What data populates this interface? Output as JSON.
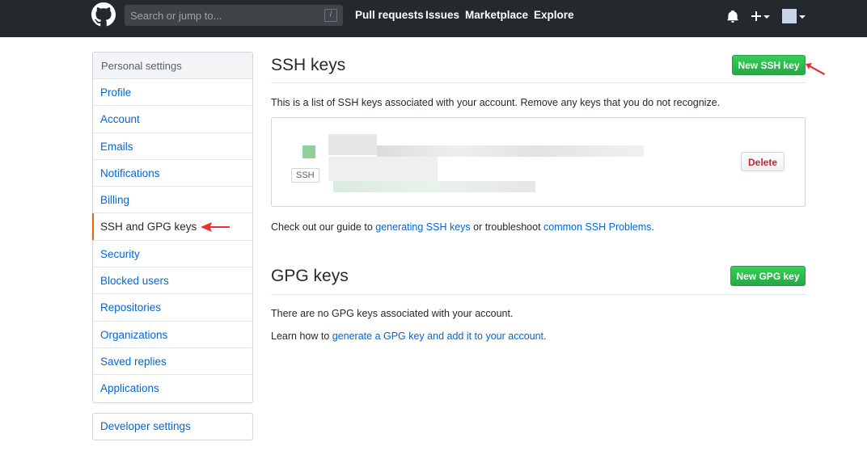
{
  "header": {
    "search_placeholder": "Search or jump to...",
    "slash_key": "/",
    "nav": [
      "Pull requests",
      "Issues",
      "Marketplace",
      "Explore"
    ]
  },
  "sidebar": {
    "heading": "Personal settings",
    "items": [
      "Profile",
      "Account",
      "Emails",
      "Notifications",
      "Billing",
      "SSH and GPG keys",
      "Security",
      "Blocked users",
      "Repositories",
      "Organizations",
      "Saved replies",
      "Applications"
    ],
    "selected_index": 5,
    "developer_settings": "Developer settings"
  },
  "ssh": {
    "title": "SSH keys",
    "new_button": "New SSH key",
    "description": "This is a list of SSH keys associated with your account. Remove any keys that you do not recognize.",
    "key_label": "SSH",
    "delete_button": "Delete",
    "guide_prefix": "Check out our guide to ",
    "guide_link": "generating SSH keys",
    "guide_middle": " or troubleshoot ",
    "guide_link2": "common SSH Problems",
    "guide_suffix": "."
  },
  "gpg": {
    "title": "GPG keys",
    "new_button": "New GPG key",
    "empty": "There are no GPG keys associated with your account.",
    "learn_prefix": "Learn how to ",
    "learn_link": "generate a GPG key and add it to your account",
    "learn_suffix": "."
  },
  "colors": {
    "header_bg": "#24292e",
    "link": "#0366d6",
    "green": "#28a745",
    "danger": "#cb2431",
    "selected_marker": "#e36209",
    "annotation_arrow": "#e8312f"
  }
}
